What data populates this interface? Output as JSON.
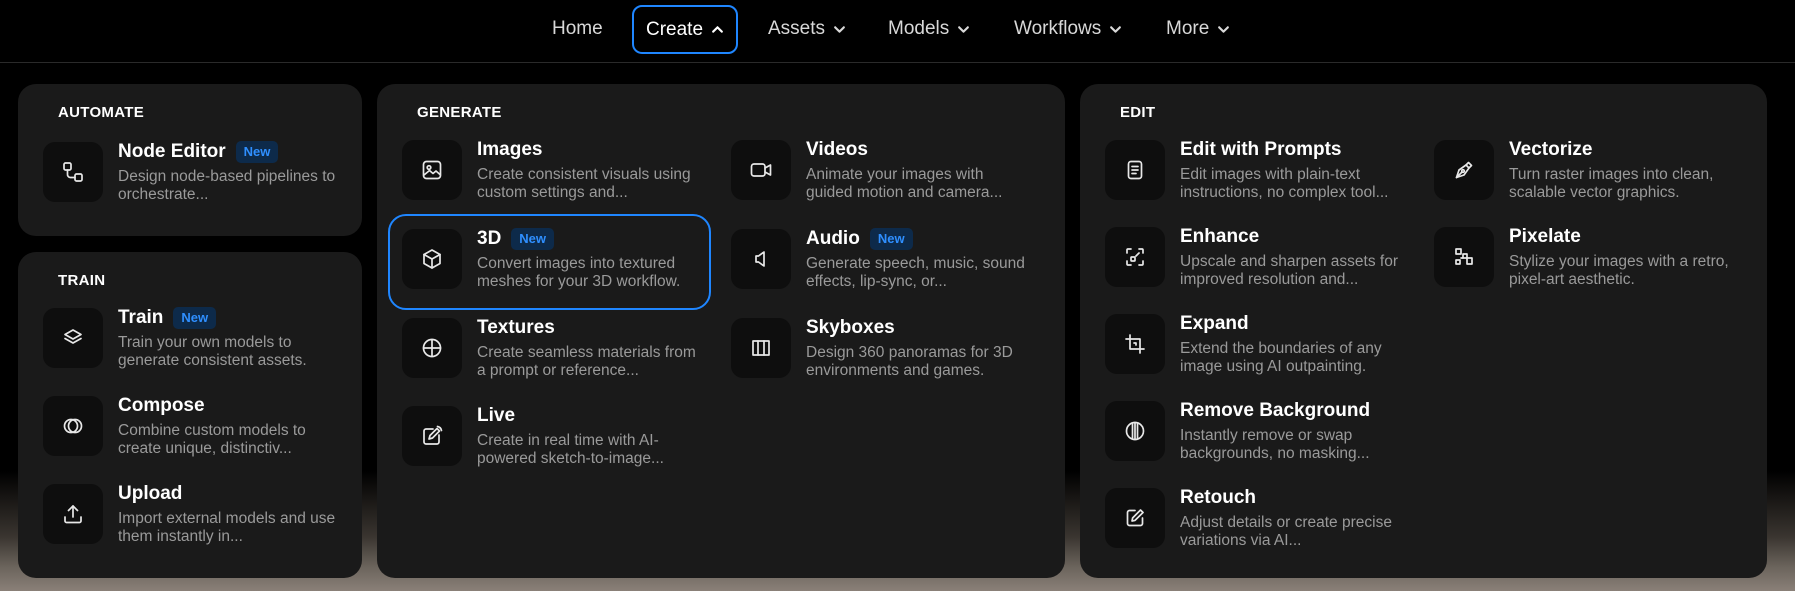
{
  "nav": {
    "items": [
      {
        "label": "Home"
      },
      {
        "label": "Create"
      },
      {
        "label": "Assets"
      },
      {
        "label": "Models"
      },
      {
        "label": "Workflows"
      },
      {
        "label": "More"
      }
    ]
  },
  "automate": {
    "title": "AUTOMATE",
    "items": [
      {
        "title": "Node Editor",
        "badge": "New",
        "desc": "Design node-based pipelines to orchestrate...",
        "icon": "node-editor-icon"
      }
    ]
  },
  "train": {
    "title": "TRAIN",
    "items": [
      {
        "title": "Train",
        "badge": "New",
        "desc": "Train your own models to generate consistent assets.",
        "icon": "layers-icon"
      },
      {
        "title": "Compose",
        "desc": "Combine custom models to create unique, distinctiv...",
        "icon": "compose-icon"
      },
      {
        "title": "Upload",
        "desc": "Import external models and use them instantly in...",
        "icon": "upload-icon"
      }
    ]
  },
  "generate": {
    "title": "GENERATE",
    "items": [
      {
        "title": "Images",
        "desc": "Create consistent visuals using custom settings and...",
        "icon": "image-icon"
      },
      {
        "title": "Videos",
        "desc": "Animate your images with guided motion and camera...",
        "icon": "video-icon"
      },
      {
        "title": "3D",
        "badge": "New",
        "desc": "Convert images into textured meshes for your 3D workflow.",
        "icon": "cube-icon"
      },
      {
        "title": "Audio",
        "badge": "New",
        "desc": "Generate speech, music, sound effects, lip-sync, or...",
        "icon": "speaker-icon"
      },
      {
        "title": "Textures",
        "desc": "Create seamless materials from a prompt or reference...",
        "icon": "sphere-icon"
      },
      {
        "title": "Skyboxes",
        "desc": "Design 360 panoramas for 3D environments and games.",
        "icon": "panorama-icon"
      },
      {
        "title": "Live",
        "desc": "Create in real time with AI-powered sketch-to-image...",
        "icon": "live-pen-icon"
      }
    ]
  },
  "edit": {
    "title": "EDIT",
    "items": [
      {
        "title": "Edit with Prompts",
        "desc": "Edit images with plain-text instructions, no complex tool...",
        "icon": "document-icon"
      },
      {
        "title": "Vectorize",
        "desc": "Turn raster images into clean, scalable vector graphics.",
        "icon": "pen-nib-icon"
      },
      {
        "title": "Enhance",
        "desc": "Upscale and sharpen assets for improved resolution and...",
        "icon": "enhance-icon"
      },
      {
        "title": "Pixelate",
        "desc": "Stylize your images with a retro, pixel-art aesthetic.",
        "icon": "pixel-icon"
      },
      {
        "title": "Expand",
        "desc": "Extend the boundaries of any image using AI outpainting.",
        "icon": "crop-icon"
      },
      {
        "title": "Remove Background",
        "desc": "Instantly remove or swap backgrounds, no masking...",
        "icon": "remove-bg-icon"
      },
      {
        "title": "Retouch",
        "desc": "Adjust details or create precise variations via AI...",
        "icon": "edit-icon"
      }
    ]
  },
  "colors": {
    "accent": "#1f86ff",
    "panel": "#1a1a1a",
    "badge_text": "#2f8fff"
  }
}
